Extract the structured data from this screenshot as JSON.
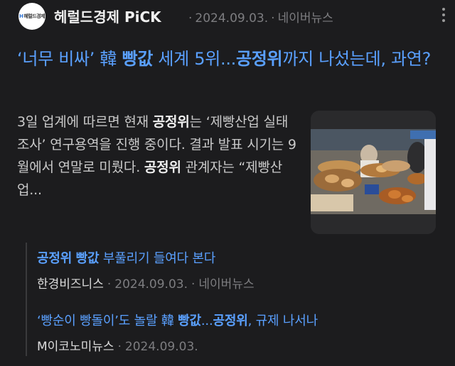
{
  "header": {
    "logo_text": "헤럴드경제",
    "press_name": "헤럴드경제 PiCK",
    "date": "2024.09.03.",
    "source": "네이버뉴스",
    "more_icon": "more-vertical-icon"
  },
  "article": {
    "title_parts": [
      "‘너무 비싸’ 韓 ",
      "빵값",
      " 세계 5위...",
      "공정위",
      "까지 나섰는데, 과연?"
    ],
    "summary_parts": [
      "3일 업계에 따르면 현재 ",
      "공정위",
      "는 ‘제빵산업 실태 조사’ 연구용역을 진행 중이다. 결과 발표 시기는 9월에서 연말로 미뤘다. ",
      "공정위",
      " 관계자는 “제빵산업..."
    ],
    "thumbnail_alt": "bakery-display-photo"
  },
  "related": [
    {
      "title_parts": [
        "공정위",
        " ",
        "빵값",
        " 부풀리기 들여다 본다"
      ],
      "source": "한경비즈니스",
      "date": "2024.09.03.",
      "platform": "네이버뉴스"
    },
    {
      "title_parts": [
        "‘빵순이 빵돌이’도 놀랄 韓 ",
        "빵값",
        "...",
        "공정위",
        ", 규제 나서나"
      ],
      "source": "M이코노미뉴스",
      "date": "2024.09.03.",
      "platform": ""
    }
  ],
  "colors": {
    "background": "#1c1c1e",
    "link": "#5aa0ff",
    "meta": "#7d7d80"
  }
}
